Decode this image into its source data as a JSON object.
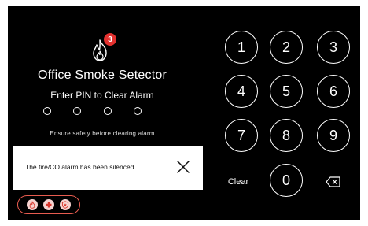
{
  "device": {
    "title": "Office Smoke Setector",
    "alarm_count": "3",
    "prompt": "Enter PIN to Clear Alarm",
    "pin_length": 4,
    "hint": "Ensure safety before clearing alarm"
  },
  "notification": {
    "message": "The fire/CO alarm has been silenced"
  },
  "keypad": {
    "keys": [
      "1",
      "2",
      "3",
      "4",
      "5",
      "6",
      "7",
      "8",
      "9",
      "0"
    ],
    "clear_label": "Clear"
  },
  "status_icons": [
    "fire-icon",
    "medical-icon",
    "police-icon"
  ],
  "colors": {
    "background": "#000000",
    "badge": "#e3312f",
    "status_border": "#e85c50",
    "status_icon_bg": "#f6d3d0",
    "toast_bg": "#ffffff"
  }
}
